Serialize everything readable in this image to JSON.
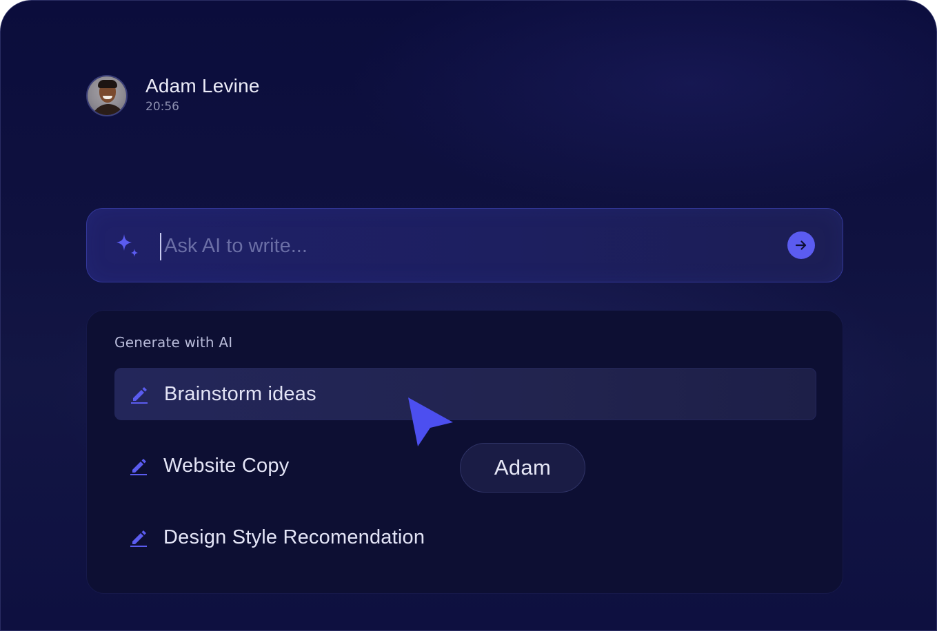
{
  "user": {
    "name": "Adam Levine",
    "time": "20:56"
  },
  "prompt": {
    "placeholder": "Ask AI to write...",
    "value": "",
    "left_icon": "sparkle-icon",
    "send_icon": "arrow-right-icon"
  },
  "panel": {
    "title": "Generate with AI",
    "item_icon": "pencil-icon",
    "items": [
      {
        "label": "Brainstorm ideas",
        "active": true
      },
      {
        "label": "Website Copy",
        "active": false
      },
      {
        "label": "Design Style Recomendation",
        "active": false
      }
    ]
  },
  "cursor": {
    "name_tag": "Adam"
  },
  "colors": {
    "accent": "#5b5cf0",
    "background": "#0f113f",
    "panel": "#0d0f33",
    "text": "#e3e4f6"
  }
}
